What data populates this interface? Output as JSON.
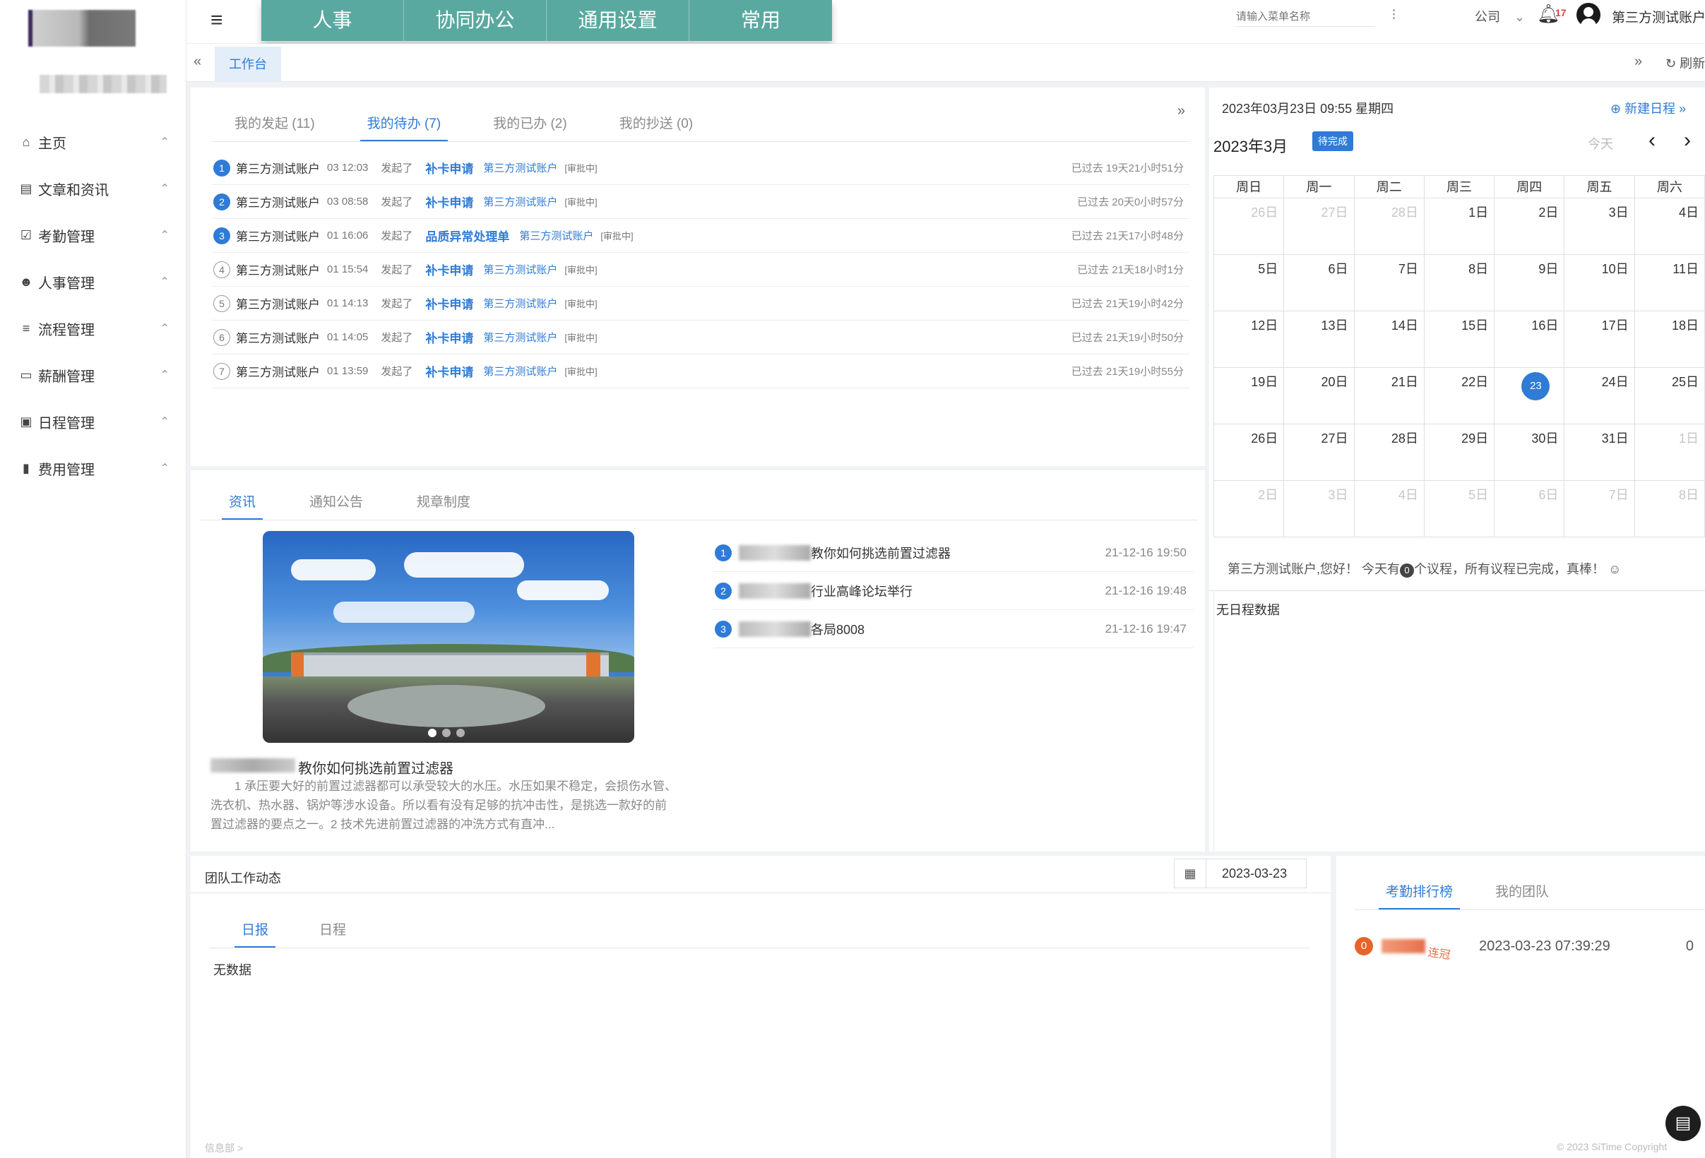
{
  "sidebar": {
    "company_name": "",
    "menu": [
      {
        "icon": "home-icon",
        "glyph": "⌂",
        "label": "主页"
      },
      {
        "icon": "newspaper-icon",
        "glyph": "▤",
        "label": "文章和资讯"
      },
      {
        "icon": "calendar-check-icon",
        "glyph": "☑",
        "label": "考勤管理"
      },
      {
        "icon": "users-icon",
        "glyph": "☻",
        "label": "人事管理"
      },
      {
        "icon": "list-icon",
        "glyph": "≡",
        "label": "流程管理"
      },
      {
        "icon": "credit-card-icon",
        "glyph": "▭",
        "label": "薪酬管理"
      },
      {
        "icon": "monitor-icon",
        "glyph": "▣",
        "label": "日程管理"
      },
      {
        "icon": "document-icon",
        "glyph": "▮",
        "label": "费用管理"
      }
    ],
    "caret": "⌃"
  },
  "topbar": {
    "menu": [
      "人事",
      "协同办公",
      "通用设置",
      "常用"
    ],
    "search_placeholder": "请输入菜单名称",
    "more": "⁝",
    "company": "公司",
    "notification_count": "17",
    "username": "第三方测试账户"
  },
  "tabstrip": {
    "active_tab": "工作台",
    "refresh": "刷新"
  },
  "todo": {
    "tabs": [
      "我的发起 (11)",
      "我的待办 (7)",
      "我的已办 (2)",
      "我的抄送 (0)"
    ],
    "active_tab_index": 1,
    "rows": [
      {
        "num": "1",
        "user": "第三方测试账户",
        "time": "03 12:03",
        "action": "发起了",
        "type": "补卡申请",
        "account": "第三方测试账户",
        "status": "[审批中]",
        "elapsed": "已过去 19天21小时51分",
        "filled": true
      },
      {
        "num": "2",
        "user": "第三方测试账户",
        "time": "03 08:58",
        "action": "发起了",
        "type": "补卡申请",
        "account": "第三方测试账户",
        "status": "[审批中]",
        "elapsed": "已过去 20天0小时57分",
        "filled": true
      },
      {
        "num": "3",
        "user": "第三方测试账户",
        "time": "01 16:06",
        "action": "发起了",
        "type": "品质异常处理单",
        "account": "第三方测试账户",
        "status": "[审批中]",
        "elapsed": "已过去 21天17小时48分",
        "filled": true
      },
      {
        "num": "4",
        "user": "第三方测试账户",
        "time": "01 15:54",
        "action": "发起了",
        "type": "补卡申请",
        "account": "第三方测试账户",
        "status": "[审批中]",
        "elapsed": "已过去 21天18小时1分",
        "filled": false
      },
      {
        "num": "5",
        "user": "第三方测试账户",
        "time": "01 14:13",
        "action": "发起了",
        "type": "补卡申请",
        "account": "第三方测试账户",
        "status": "[审批中]",
        "elapsed": "已过去 21天19小时42分",
        "filled": false
      },
      {
        "num": "6",
        "user": "第三方测试账户",
        "time": "01 14:05",
        "action": "发起了",
        "type": "补卡申请",
        "account": "第三方测试账户",
        "status": "[审批中]",
        "elapsed": "已过去 21天19小时50分",
        "filled": false
      },
      {
        "num": "7",
        "user": "第三方测试账户",
        "time": "01 13:59",
        "action": "发起了",
        "type": "补卡申请",
        "account": "第三方测试账户",
        "status": "[审批中]",
        "elapsed": "已过去 21天19小时55分",
        "filled": false
      }
    ]
  },
  "news": {
    "tabs": [
      "资讯",
      "通知公告",
      "规章制度"
    ],
    "active_tab_index": 0,
    "featured_title": "教你如何挑选前置过滤器",
    "featured_excerpt": "1 承压要大好的前置过滤器都可以承受较大的水压。水压如果不稳定，会损伤水管、洗衣机、热水器、锅炉等涉水设备。所以看有没有足够的抗冲击性，是挑选一款好的前置过滤器的要点之一。2 技术先进前置过滤器的冲洗方式有直冲...",
    "carousel_active": 0,
    "items": [
      {
        "num": "1",
        "text": "教你如何挑选前置过滤器",
        "date": "21-12-16 19:50"
      },
      {
        "num": "2",
        "text": "行业高峰论坛举行",
        "date": "21-12-16 19:48"
      },
      {
        "num": "3",
        "text": "各局8008",
        "date": "21-12-16 19:47"
      }
    ]
  },
  "calendar": {
    "datetime": "2023年03月23日 09:55 星期四",
    "new_event": "新建日程",
    "month_title": "2023年3月",
    "badge": "待完成",
    "today_label": "今天",
    "weekdays": [
      "周日",
      "周一",
      "周二",
      "周三",
      "周四",
      "周五",
      "周六"
    ],
    "weeks": [
      [
        {
          "d": "26日",
          "o": true
        },
        {
          "d": "27日",
          "o": true
        },
        {
          "d": "28日",
          "o": true
        },
        {
          "d": "1日"
        },
        {
          "d": "2日"
        },
        {
          "d": "3日"
        },
        {
          "d": "4日"
        }
      ],
      [
        {
          "d": "5日"
        },
        {
          "d": "6日"
        },
        {
          "d": "7日"
        },
        {
          "d": "8日"
        },
        {
          "d": "9日"
        },
        {
          "d": "10日"
        },
        {
          "d": "11日"
        }
      ],
      [
        {
          "d": "12日"
        },
        {
          "d": "13日"
        },
        {
          "d": "14日"
        },
        {
          "d": "15日"
        },
        {
          "d": "16日"
        },
        {
          "d": "17日"
        },
        {
          "d": "18日"
        }
      ],
      [
        {
          "d": "19日"
        },
        {
          "d": "20日"
        },
        {
          "d": "21日"
        },
        {
          "d": "22日"
        },
        {
          "d": "23",
          "t": true
        },
        {
          "d": "24日"
        },
        {
          "d": "25日"
        }
      ],
      [
        {
          "d": "26日"
        },
        {
          "d": "27日"
        },
        {
          "d": "28日"
        },
        {
          "d": "29日"
        },
        {
          "d": "30日"
        },
        {
          "d": "31日"
        },
        {
          "d": "1日",
          "o": true
        }
      ],
      [
        {
          "d": "2日",
          "o": true
        },
        {
          "d": "3日",
          "o": true
        },
        {
          "d": "4日",
          "o": true
        },
        {
          "d": "5日",
          "o": true
        },
        {
          "d": "6日",
          "o": true
        },
        {
          "d": "7日",
          "o": true
        },
        {
          "d": "8日",
          "o": true
        }
      ]
    ],
    "greeting_pre": "第三方测试账户,您好！ 今天有",
    "greeting_count": "0",
    "greeting_post": "个议程，所有议程已完成，真棒！ ☺",
    "empty": "无日程数据"
  },
  "team": {
    "title": "团队工作动态",
    "date": "2023-03-23",
    "tabs": [
      "日报",
      "日程"
    ],
    "active_tab_index": 0,
    "empty": "无数据",
    "footer": "信息部 >"
  },
  "rank": {
    "tabs": [
      "考勤排行榜",
      "我的团队"
    ],
    "active_tab_index": 0,
    "rows": [
      {
        "rank": "0",
        "tag": "连冠",
        "time": "2023-03-23 07:39:29",
        "count": "0"
      }
    ],
    "footer": "© 2023 SiTime Copyright"
  }
}
